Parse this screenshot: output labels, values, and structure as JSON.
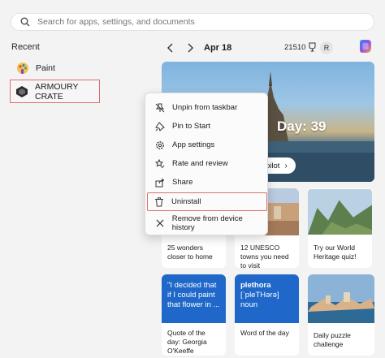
{
  "search": {
    "placeholder": "Search for apps, settings, and documents",
    "icon": "search-icon"
  },
  "recent": {
    "title": "Recent",
    "items": [
      {
        "label": "Paint",
        "icon": "paint-app-icon"
      },
      {
        "label": "ARMOURY CRATE",
        "icon": "armoury-crate-app-icon"
      }
    ]
  },
  "nav": {
    "date": "Apr 18",
    "points": "21510",
    "avatar": "R"
  },
  "hero": {
    "title": "Day: 39",
    "pill": "pilot"
  },
  "context_menu": {
    "items": [
      {
        "label": "Unpin from taskbar",
        "icon": "unpin-icon"
      },
      {
        "label": "Pin to Start",
        "icon": "pin-icon"
      },
      {
        "label": "App settings",
        "icon": "gear-icon"
      },
      {
        "label": "Rate and review",
        "icon": "rate-review-icon"
      },
      {
        "label": "Share",
        "icon": "share-icon"
      },
      {
        "label": "Uninstall",
        "icon": "trash-icon"
      },
      {
        "label": "Remove from device history",
        "icon": "close-icon"
      }
    ]
  },
  "tiles": {
    "row1": [
      {
        "caption": "25 wonders closer to home"
      },
      {
        "caption": "12 UNESCO towns you need to visit"
      },
      {
        "caption": "Try our World Heritage quiz!"
      }
    ],
    "row2": [
      {
        "top": "\"I decided that if I could paint that flower in ...",
        "caption": "Quote of the day: Georgia O'Keeffe"
      },
      {
        "top_word": "plethora",
        "top_pron": "[ˈpleTHərə]",
        "top_pos": "noun",
        "caption": "Word of the day"
      },
      {
        "caption": "Daily puzzle challenge"
      }
    ]
  },
  "colors": {
    "accent": "#1f68c9",
    "highlight_border": "#e06d6d"
  }
}
